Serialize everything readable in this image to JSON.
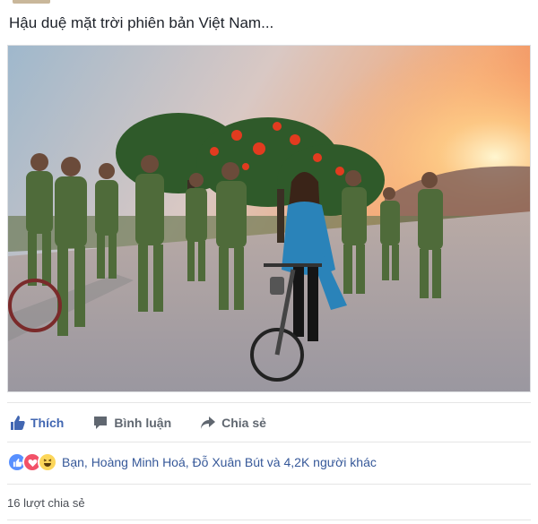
{
  "post": {
    "text": "Hậu duệ mặt trời phiên bản Việt Nam..."
  },
  "actions": {
    "like_label": "Thích",
    "comment_label": "Bình luận",
    "share_label": "Chia sẻ",
    "accent_color": "#4267b2"
  },
  "reactions": {
    "icons": [
      "like-icon",
      "love-icon",
      "haha-icon"
    ],
    "summary": "Bạn, Hoàng Minh Hoá, Đỗ Xuân Bút và 4,2K người khác"
  },
  "shares": {
    "label": "16 lượt chia sẻ"
  }
}
